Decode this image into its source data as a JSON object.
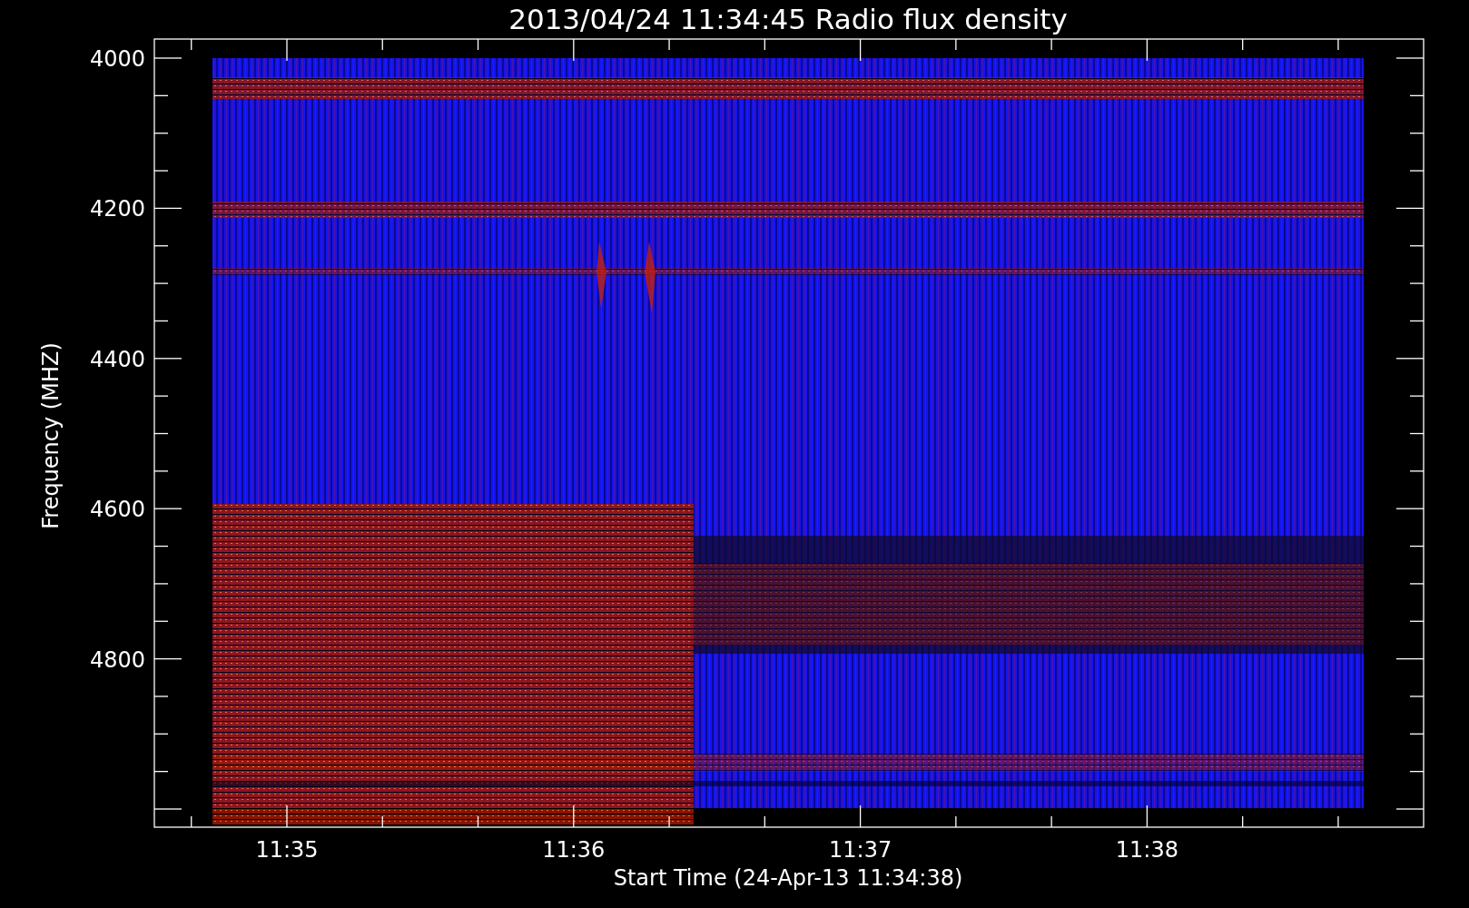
{
  "title": "2013/04/24 11:34:45 Radio flux density",
  "y_axis": {
    "label": "Frequency (MHZ)",
    "ticks": [
      "4000",
      "4200",
      "4400",
      "4600",
      "4800"
    ]
  },
  "x_axis": {
    "label": "Start Time (24-Apr-13 11:34:38)",
    "ticks": [
      "11:35",
      "11:36",
      "11:37",
      "11:38"
    ]
  }
}
